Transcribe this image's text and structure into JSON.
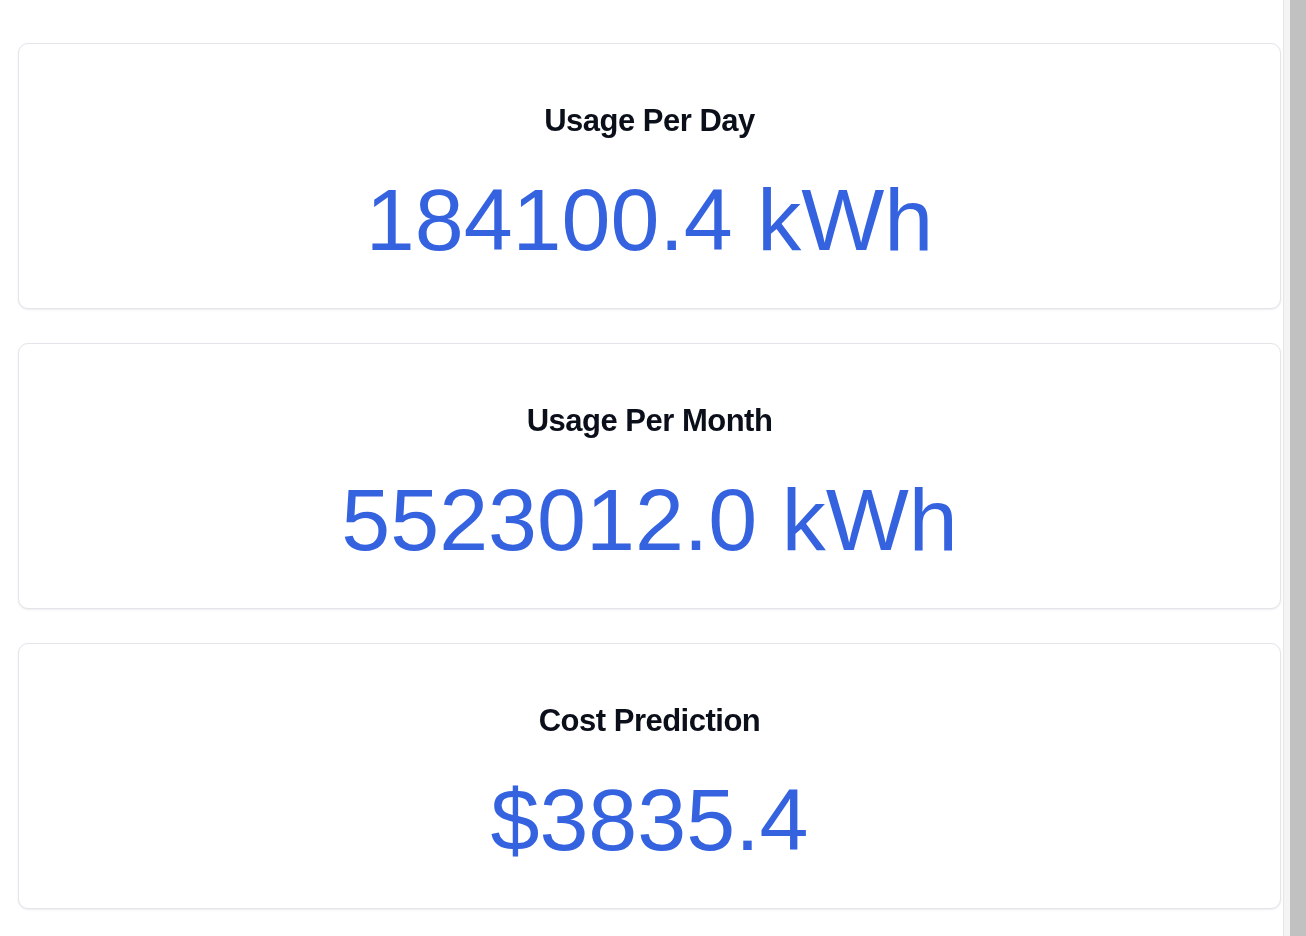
{
  "cards": [
    {
      "title": "Usage Per Day",
      "value": "184100.4 kWh"
    },
    {
      "title": "Usage Per Month",
      "value": "5523012.0 kWh"
    },
    {
      "title": "Cost Prediction",
      "value": "$3835.4"
    }
  ]
}
